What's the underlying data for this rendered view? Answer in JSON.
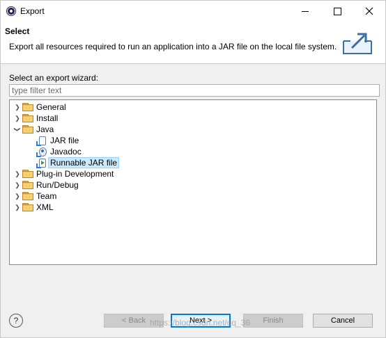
{
  "window": {
    "title": "Export"
  },
  "header": {
    "title": "Select",
    "description": "Export all resources required to run an application into a JAR file on the local file system."
  },
  "wizard": {
    "label": "Select an export wizard:",
    "filter_placeholder": "type filter text"
  },
  "tree": {
    "items": [
      {
        "label": "General",
        "expanded": false,
        "icon": "folder-icon"
      },
      {
        "label": "Install",
        "expanded": false,
        "icon": "folder-icon"
      },
      {
        "label": "Java",
        "expanded": true,
        "icon": "folder-icon"
      },
      {
        "label": "JAR file",
        "icon": "jar-file-icon"
      },
      {
        "label": "Javadoc",
        "icon": "javadoc-icon"
      },
      {
        "label": "Runnable JAR file",
        "icon": "runnable-jar-icon",
        "selected": true
      },
      {
        "label": "Plug-in Development",
        "expanded": false,
        "icon": "folder-icon"
      },
      {
        "label": "Run/Debug",
        "expanded": false,
        "icon": "folder-icon"
      },
      {
        "label": "Team",
        "expanded": false,
        "icon": "folder-icon"
      },
      {
        "label": "XML",
        "expanded": false,
        "icon": "folder-icon"
      }
    ]
  },
  "buttons": {
    "back": "< Back",
    "next": "Next >",
    "finish": "Finish",
    "cancel": "Cancel"
  },
  "watermark": "https://blog.csdn.net/qq_36"
}
